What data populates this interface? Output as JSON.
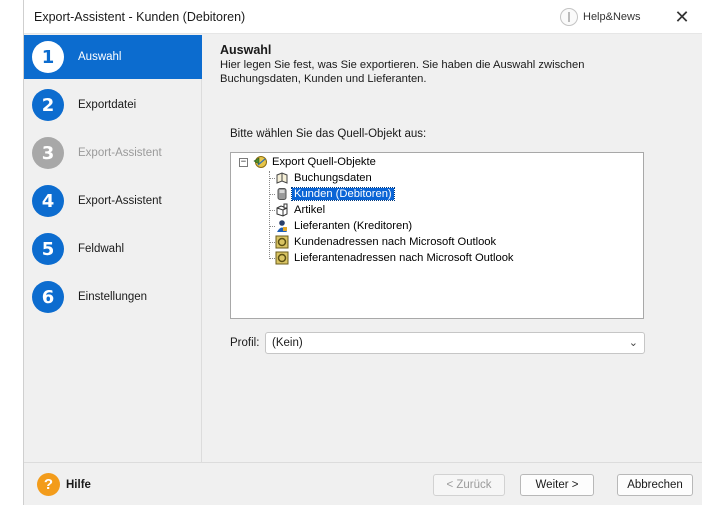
{
  "window": {
    "title": "Export-Assistent - Kunden (Debitoren)",
    "help_label": "Help&News",
    "close_glyph": "✕"
  },
  "steps": [
    {
      "num": "1",
      "label": "Auswahl",
      "state": "active"
    },
    {
      "num": "2",
      "label": "Exportdatei",
      "state": "normal"
    },
    {
      "num": "3",
      "label": "Export-Assistent",
      "state": "disabled"
    },
    {
      "num": "4",
      "label": "Export-Assistent",
      "state": "normal"
    },
    {
      "num": "5",
      "label": "Feldwahl",
      "state": "normal"
    },
    {
      "num": "6",
      "label": "Einstellungen",
      "state": "normal"
    }
  ],
  "header": {
    "title": "Auswahl",
    "description": "Hier legen Sie fest, was Sie exportieren. Sie haben die Auswahl zwischen Buchungsdaten, Kunden und Lieferanten."
  },
  "tree": {
    "prompt": "Bitte wählen Sie das Quell-Objekt aus:",
    "root": "Export Quell-Objekte",
    "root_expander": "−",
    "items": [
      {
        "label": "Buchungsdaten",
        "icon": "book-icon",
        "selected": false
      },
      {
        "label": "Kunden (Debitoren)",
        "icon": "customer-icon",
        "selected": true
      },
      {
        "label": "Artikel",
        "icon": "article-icon",
        "selected": false
      },
      {
        "label": "Lieferanten (Kreditoren)",
        "icon": "supplier-icon",
        "selected": false
      },
      {
        "label": "Kundenadressen nach Microsoft Outlook",
        "icon": "outlook-icon",
        "selected": false
      },
      {
        "label": "Lieferantenadressen nach Microsoft Outlook",
        "icon": "outlook-icon",
        "selected": false
      }
    ]
  },
  "profil": {
    "label": "Profil:",
    "value": "(Kein)"
  },
  "footer": {
    "help_label": "Hilfe",
    "help_glyph": "?",
    "back_label": "< Zurück",
    "next_label": "Weiter >",
    "cancel_label": "Abbrechen"
  },
  "colors": {
    "accent": "#0c6ccf",
    "selection": "#0a64d6",
    "help_orange": "#f39c1b"
  }
}
